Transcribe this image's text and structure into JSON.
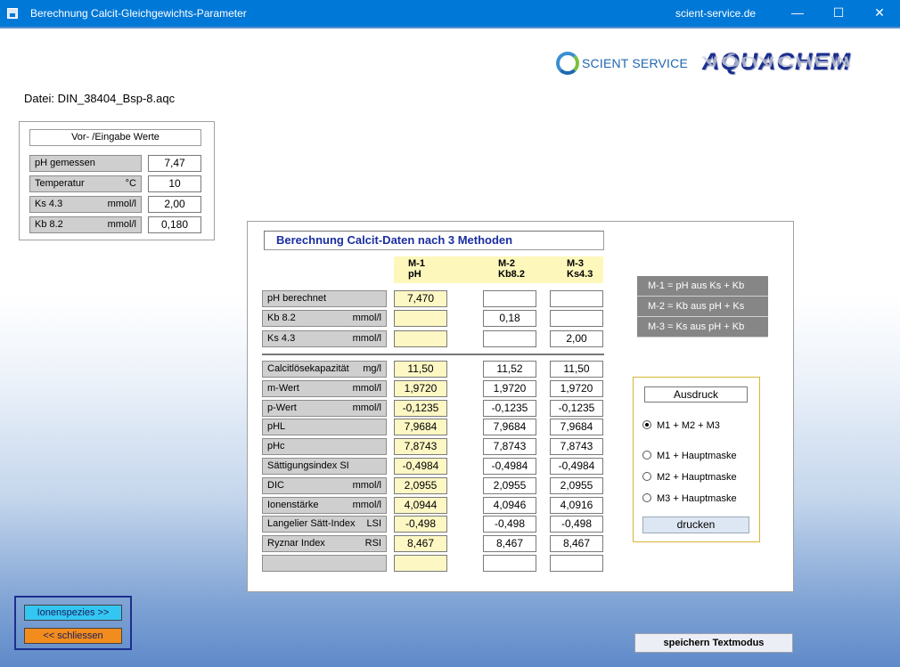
{
  "window": {
    "title": "Berechnung Calcit-Gleichgewichts-Parameter",
    "site": "scient-service.de",
    "minimize": "—",
    "maximize": "☐",
    "close": "✕"
  },
  "logos": {
    "scient_service": "SCIENT SERVICE",
    "aquachem": "AQUACHEM"
  },
  "datei": "Datei:  DIN_38404_Bsp-8.aqc",
  "input_panel": {
    "title": "Vor- /Eingabe Werte",
    "rows": [
      {
        "label": "pH  gemessen",
        "unit": "",
        "value": "7,47"
      },
      {
        "label": "Temperatur",
        "unit": "°C",
        "value": "10"
      },
      {
        "label": "Ks 4.3",
        "unit": "mmol/l",
        "value": "2,00"
      },
      {
        "label": "Kb 8.2",
        "unit": "mmol/l",
        "value": "0,180"
      }
    ]
  },
  "calc_panel": {
    "title": "Berechnung  Calcit-Daten nach 3 Methoden",
    "columns": [
      {
        "line1": "M-1",
        "line2": "pH"
      },
      {
        "line1": "M-2",
        "line2": "Kb8.2"
      },
      {
        "line1": "M-3",
        "line2": "Ks4.3"
      }
    ],
    "top_rows": [
      {
        "label": "pH berechnet",
        "unit": "",
        "values": [
          "7,470",
          "",
          ""
        ]
      },
      {
        "label": "Kb 8.2",
        "unit": "mmol/l",
        "values": [
          "",
          "0,18",
          ""
        ]
      },
      {
        "label": "Ks 4.3",
        "unit": "mmol/l",
        "values": [
          "",
          "",
          "2,00"
        ]
      }
    ],
    "rows": [
      {
        "label": "Calcitlösekapazität",
        "unit": "mg/l",
        "values": [
          "11,50",
          "11,52",
          "11,50"
        ]
      },
      {
        "label": "m-Wert",
        "unit": "mmol/l",
        "values": [
          "1,9720",
          "1,9720",
          "1,9720"
        ]
      },
      {
        "label": "p-Wert",
        "unit": "mmol/l",
        "values": [
          "-0,1235",
          "-0,1235",
          "-0,1235"
        ]
      },
      {
        "label": "pHL",
        "unit": "",
        "values": [
          "7,9684",
          "7,9684",
          "7,9684"
        ]
      },
      {
        "label": "pHc",
        "unit": "",
        "values": [
          "7,8743",
          "7,8743",
          "7,8743"
        ]
      },
      {
        "label": "Sättigungsindex  SI",
        "unit": "",
        "values": [
          "-0,4984",
          "-0,4984",
          "-0,4984"
        ]
      },
      {
        "label": "DIC",
        "unit": "mmol/l",
        "values": [
          "2,0955",
          "2,0955",
          "2,0955"
        ]
      },
      {
        "label": "Ionenstärke",
        "unit": "mmol/l",
        "values": [
          "4,0944",
          "4,0946",
          "4,0916"
        ]
      },
      {
        "label": "Langelier Sätt-Index",
        "unit": "LSI",
        "values": [
          "-0,498",
          "-0,498",
          "-0,498"
        ]
      },
      {
        "label": "Ryznar Index",
        "unit": "RSI",
        "values": [
          "8,467",
          "8,467",
          "8,467"
        ]
      },
      {
        "label": "",
        "unit": "",
        "values": [
          "",
          "",
          ""
        ]
      }
    ],
    "legend": [
      "M-1  =  pH   aus  Ks + Kb",
      "M-2  =  Kb   aus  pH + Ks",
      "M-3  =  Ks   aus   pH + Kb"
    ],
    "print": {
      "title": "Ausdruck",
      "options": [
        "M1 + M2 + M3",
        "M1 + Hauptmaske",
        "M2 + Hauptmaske",
        "M3 + Hauptmaske"
      ],
      "selected": 0,
      "button": "drucken"
    }
  },
  "buttons": {
    "ionenspezies": "Ionenspezies >>",
    "schliessen": "<<  schliessen",
    "speichern": "speichern Textmodus"
  }
}
